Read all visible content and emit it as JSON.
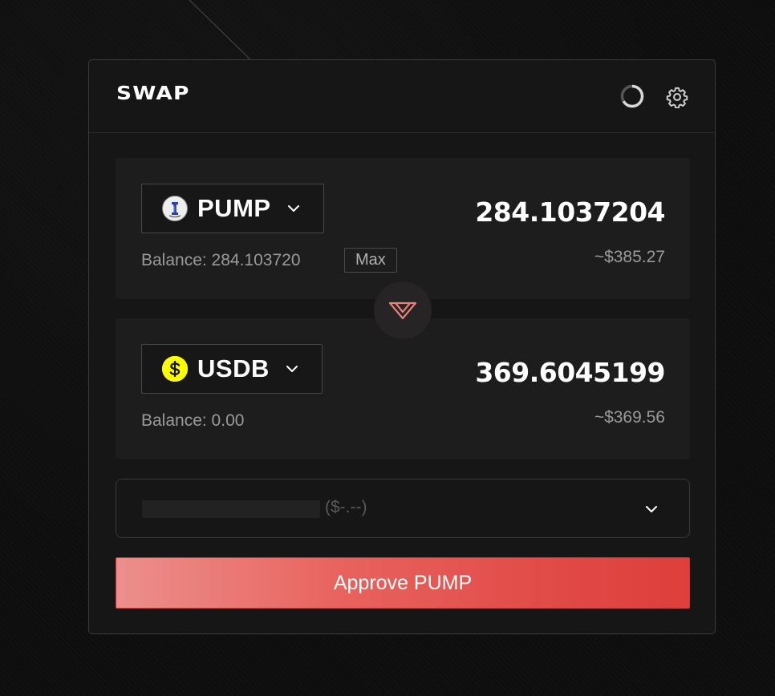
{
  "header": {
    "title": "SWAP",
    "spinner_icon": "loading-spinner-icon",
    "settings_icon": "gear-icon"
  },
  "from": {
    "token": "PUMP",
    "token_icon": "pump-token-icon",
    "balance": "Balance: 284.103720",
    "max_label": "Max",
    "amount": "284.1037204",
    "usd": "~$385.27"
  },
  "to": {
    "token": "USDB",
    "token_icon": "usdb-token-icon",
    "balance": "Balance: 0.00",
    "amount": "369.6045199",
    "usd": "~$369.56"
  },
  "swap_direction_icon": "swap-direction-icon",
  "route": {
    "price": "($-.--)"
  },
  "action": {
    "label": "Approve PUMP"
  },
  "colors": {
    "accent": "#e04845",
    "accent_light": "#ec8f8c",
    "usdb": "#fcfc03",
    "panel": "#161616",
    "card": "#1d1d1d"
  }
}
